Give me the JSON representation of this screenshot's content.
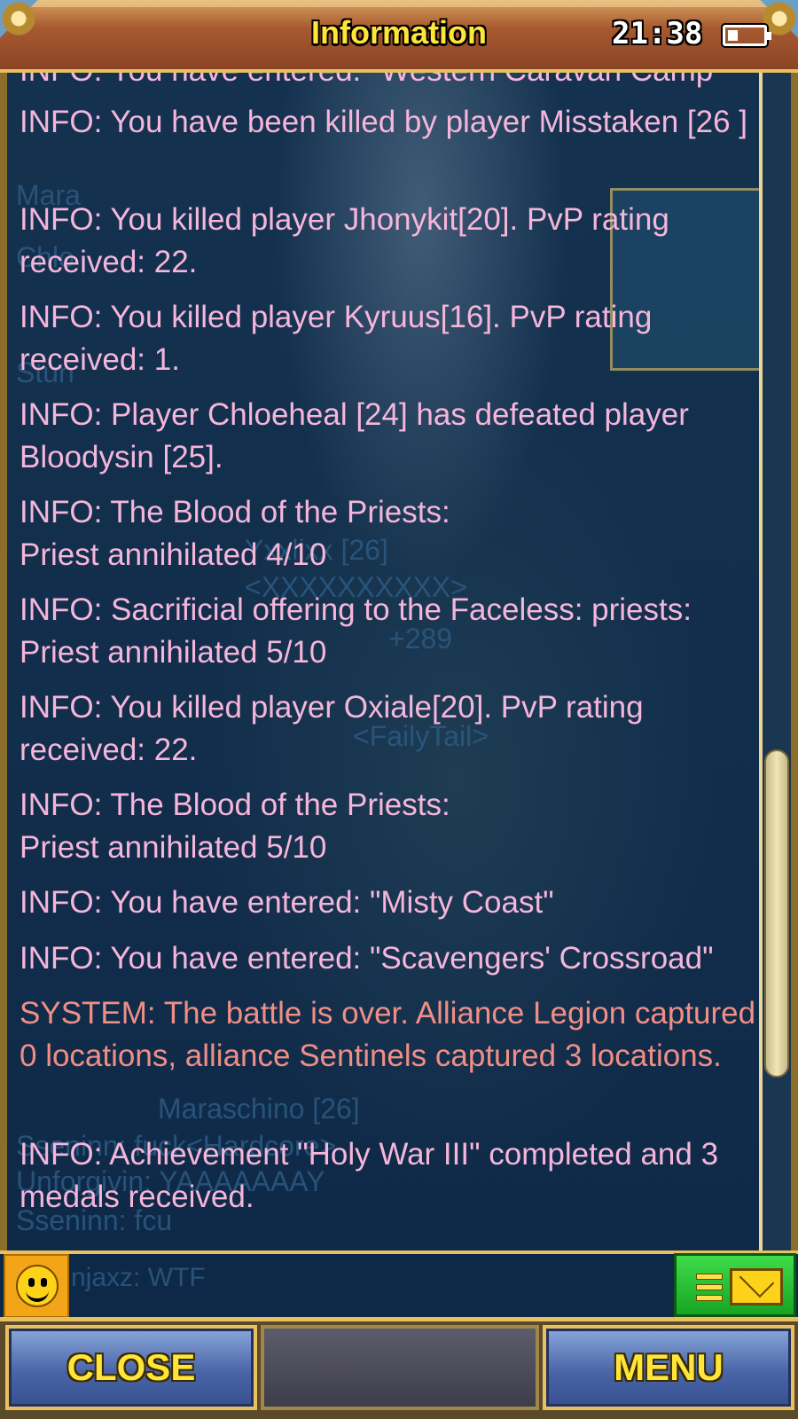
{
  "header": {
    "title": "Information",
    "time": "21:38",
    "battery_level": 0.3
  },
  "messages": [
    {
      "type": "info",
      "text": "INFO: You have entered: \"Western Caravan Camp\""
    },
    {
      "type": "info",
      "text": "INFO: You have been killed by player Misstaken [26 ]"
    },
    {
      "type": "info",
      "text": "INFO: You killed player Jhonykit[20]. PvP rating received: 22."
    },
    {
      "type": "info",
      "text": "INFO: You killed player Kyruus[16]. PvP rating received: 1."
    },
    {
      "type": "info",
      "text": "INFO: Player Chloeheal [24] has defeated player Bloodysin [25]."
    },
    {
      "type": "info",
      "text": "INFO: The Blood of the Priests:\nPriest annihilated 4/10"
    },
    {
      "type": "info",
      "text": "INFO: Sacrificial offering to the Faceless: priests: Priest annihilated 5/10"
    },
    {
      "type": "info",
      "text": "INFO: You killed player Oxiale[20]. PvP rating received: 22."
    },
    {
      "type": "info",
      "text": "INFO: The Blood of the Priests:\nPriest annihilated 5/10"
    },
    {
      "type": "info",
      "text": "INFO: You have entered: \"Misty Coast\""
    },
    {
      "type": "info",
      "text": "INFO: You have entered: \"Scavengers' Crossroad\""
    },
    {
      "type": "system",
      "text": "SYSTEM: The battle is over. Alliance Legion captured 0 locations, alliance Sentinels captured 3 locations."
    },
    {
      "type": "info",
      "text": "INFO: Achievement \"Holy War III\" completed and 3 medals received."
    }
  ],
  "background_labels": {
    "g1": "Mara",
    "g2": "Chlo",
    "g3": "Stun",
    "g4": "Yxxlixx [26]",
    "g5": "<XXXXXXXXXX>",
    "g6": "+289",
    "g7": "<FailyTail>",
    "g8": "Maraschino [26]",
    "g9": "Sseninn: fuck<Hardcore>",
    "g10": "Unforgivin: YAAAAAAAY",
    "g11": "Sseninn: fcu",
    "g12": "njaxz: WTF"
  },
  "scrollbar": {
    "position": 0.8
  },
  "buttons": {
    "close": "CLOSE",
    "menu": "MENU"
  },
  "icons": {
    "emoji": "smiley-icon",
    "mail": "mail-icon"
  }
}
